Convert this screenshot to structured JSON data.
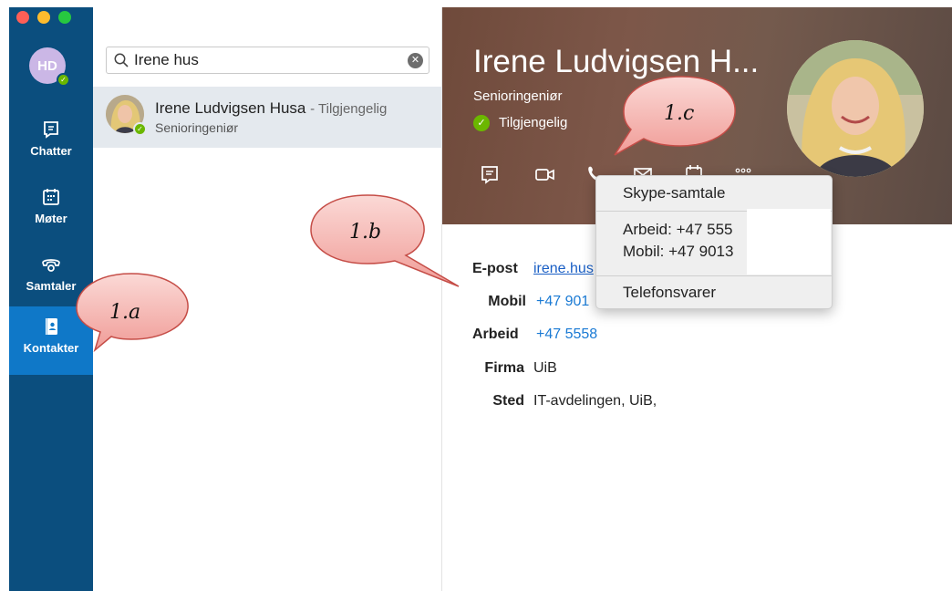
{
  "user": {
    "initials": "HD",
    "presence": "available"
  },
  "nav": {
    "items": [
      {
        "id": "chatter",
        "label": "Chatter",
        "icon": "chat-icon"
      },
      {
        "id": "moter",
        "label": "Møter",
        "icon": "calendar-icon"
      },
      {
        "id": "samtaler",
        "label": "Samtaler",
        "icon": "phone-icon"
      },
      {
        "id": "kontakter",
        "label": "Kontakter",
        "icon": "contacts-icon",
        "selected": true
      }
    ]
  },
  "search": {
    "value": "Irene hus"
  },
  "results": [
    {
      "name": "Irene Ludvigsen Husa",
      "status": "- Tilgjengelig",
      "title": "Senioringeniør"
    }
  ],
  "contact": {
    "name": "Irene Ludvigsen H...",
    "title": "Senioringeniør",
    "status": "Tilgjengelig",
    "details": {
      "email_label": "E-post",
      "email": "irene.hus",
      "mobile_label": "Mobil",
      "mobile": "+47 901",
      "work_label": "Arbeid",
      "work": "+47 5558",
      "company_label": "Firma",
      "company": "UiB",
      "location_label": "Sted",
      "location": "IT-avdelingen, UiB,"
    }
  },
  "call_menu": {
    "skype": "Skype-samtale",
    "work": "Arbeid: +47 555",
    "mobile": "Mobil: +47 9013",
    "voicemail": "Telefonsvarer"
  },
  "callouts": {
    "a": "1.a",
    "b": "1.b",
    "c": "1.c"
  },
  "colors": {
    "rail": "#0b4e7e",
    "selected_nav": "#0f78c8",
    "presence": "#6bb700",
    "link": "#1a5fc5",
    "callout_fill": "#f6b9b5"
  }
}
